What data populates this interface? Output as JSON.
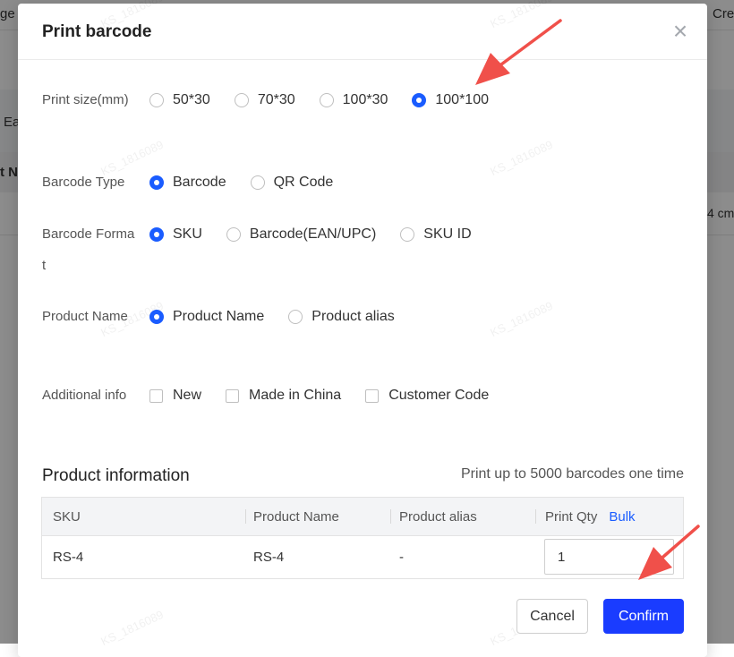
{
  "background": {
    "fragments": [
      "ge",
      "Cre",
      "Ea",
      "t N",
      "4 cm"
    ]
  },
  "modal": {
    "title": "Print barcode",
    "close_icon": "close-icon"
  },
  "form": {
    "print_size": {
      "label": "Print size(mm)",
      "options": [
        "50*30",
        "70*30",
        "100*30",
        "100*100"
      ],
      "selected": "100*100"
    },
    "barcode_type": {
      "label": "Barcode Type",
      "options": [
        "Barcode",
        "QR Code"
      ],
      "selected": "Barcode"
    },
    "barcode_format": {
      "label": "Barcode Format",
      "options": [
        "SKU",
        "Barcode(EAN/UPC)",
        "SKU ID"
      ],
      "selected": "SKU"
    },
    "product_name": {
      "label": "Product Name",
      "options": [
        "Product Name",
        "Product alias"
      ],
      "selected": "Product Name"
    },
    "additional_info": {
      "label": "Additional info",
      "options": [
        "New",
        "Made in China",
        "Customer Code"
      ]
    }
  },
  "product_info": {
    "title": "Product information",
    "hint": "Print up to 5000 barcodes one time",
    "columns": [
      "SKU",
      "Product Name",
      "Product alias",
      "Print Qty"
    ],
    "bulk_label": "Bulk",
    "rows": [
      {
        "sku": "RS-4",
        "product_name": "RS-4",
        "product_alias": "-",
        "print_qty": "1"
      }
    ]
  },
  "footer": {
    "cancel_label": "Cancel",
    "confirm_label": "Confirm"
  },
  "watermark": "KS_1816089",
  "colors": {
    "accent": "#1a5cff",
    "confirm_button": "#1a3cff",
    "annotation_arrow": "#f0504a"
  }
}
